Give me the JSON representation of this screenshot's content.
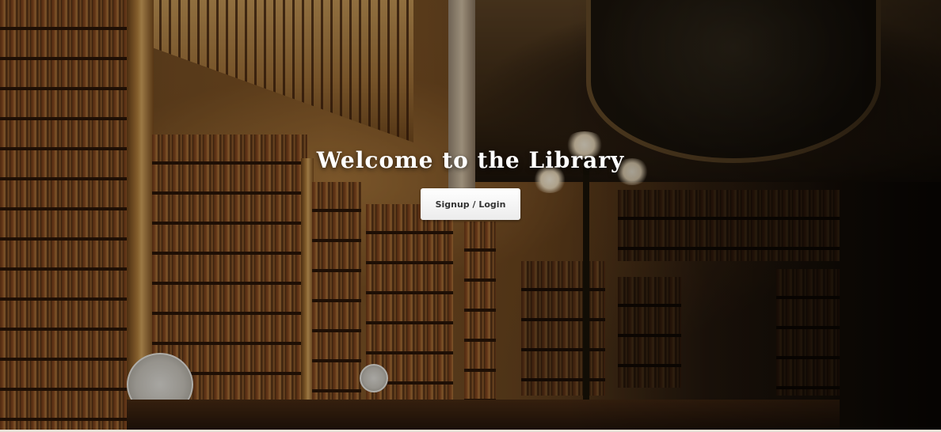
{
  "hero": {
    "title": "Welcome to the Library",
    "auth_button_label": "Signup / Login"
  },
  "background": {
    "scene": "library-interior"
  },
  "colors": {
    "title_text": "#ffffff",
    "button_bg": "#ffffff",
    "button_text": "#333333"
  }
}
